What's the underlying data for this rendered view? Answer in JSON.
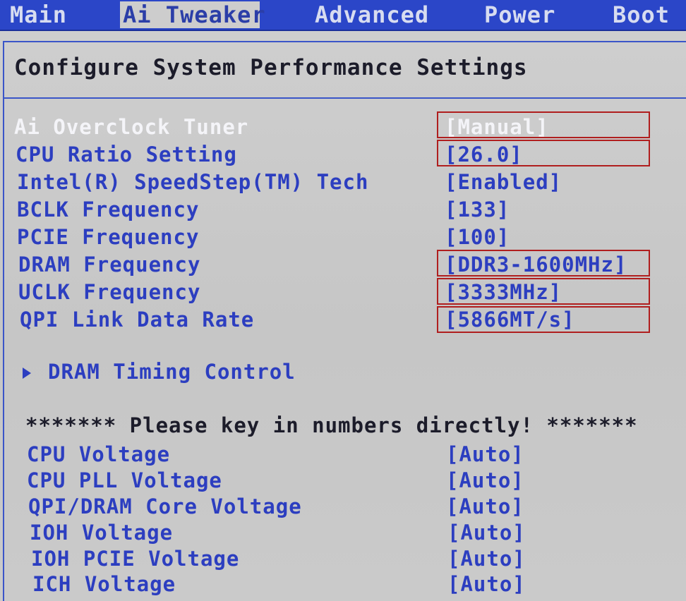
{
  "menu": {
    "tabs": [
      {
        "label": "Main"
      },
      {
        "label": "Ai Tweaker",
        "active": true
      },
      {
        "label": "Advanced"
      },
      {
        "label": "Power"
      },
      {
        "label": "Boot"
      }
    ]
  },
  "section": {
    "title": "Configure System Performance Settings"
  },
  "settings": [
    {
      "label": "Ai Overclock Tuner",
      "value": "[Manual]",
      "selected": true,
      "highlighted": true
    },
    {
      "label": "CPU Ratio Setting",
      "value": "[26.0]",
      "highlighted": true
    },
    {
      "label": "Intel(R) SpeedStep(TM) Tech",
      "value": "[Enabled]"
    },
    {
      "label": "BCLK Frequency",
      "value": "[133]"
    },
    {
      "label": "PCIE Frequency",
      "value": "[100]"
    },
    {
      "label": "DRAM Frequency",
      "value": "[DDR3-1600MHz]",
      "highlighted": true
    },
    {
      "label": "UCLK Frequency",
      "value": "[3333MHz]",
      "highlighted": true
    },
    {
      "label": "QPI Link Data Rate",
      "value": "[5866MT/s]",
      "highlighted": true
    }
  ],
  "submenu": {
    "label": "DRAM Timing Control"
  },
  "notice": {
    "text": "******* Please key in numbers directly! *******"
  },
  "voltages": [
    {
      "label": "CPU Voltage",
      "value": "[Auto]"
    },
    {
      "label": "CPU PLL Voltage",
      "value": "[Auto]"
    },
    {
      "label": "QPI/DRAM Core Voltage",
      "value": "[Auto]"
    },
    {
      "label": "IOH Voltage",
      "value": "[Auto]"
    },
    {
      "label": "IOH PCIE Voltage",
      "value": "[Auto]"
    },
    {
      "label": "ICH Voltage",
      "value": "[Auto]"
    }
  ],
  "colors": {
    "menu_bar": "#2b46c8",
    "text_blue": "#2c3ec0",
    "selected_text": "#f4f4f8",
    "highlight_box": "#b01e1e",
    "background": "#c9c9c9"
  }
}
